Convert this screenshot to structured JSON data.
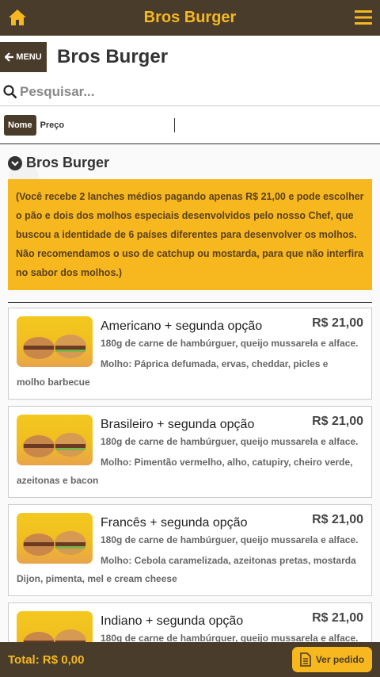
{
  "topbar": {
    "title": "Bros Burger",
    "home_icon": "home-icon",
    "menu_icon": "hamburger-menu-icon"
  },
  "header": {
    "menu_label": "MENU",
    "title": "Bros Burger"
  },
  "search": {
    "placeholder": "Pesquisar..."
  },
  "sort": {
    "active": "Nome",
    "other": "Preço"
  },
  "section": {
    "title": "Bros Burger"
  },
  "notice": "(Você recebe 2 lanches médios pagando apenas R$ 21,00 e pode escolher o pão e dois dos molhos especiais desenvolvidos pelo nosso Chef, que buscou a identidade de 6 países diferentes para desenvolver os molhos. Não recomendamos o uso de catchup ou mostarda, para que não interfira no sabor dos molhos.)",
  "products": [
    {
      "name": "Americano + segunda opção",
      "price": "R$ 21,00",
      "desc": "180g de carne de hambúrguer, queijo mussarela e alface.",
      "sauce": "Molho: Páprica defumada, ervas, cheddar, picles e molho barbecue"
    },
    {
      "name": "Brasileiro + segunda opção",
      "price": "R$ 21,00",
      "desc": "180g de carne de hambúrguer, queijo mussarela e alface.",
      "sauce": "Molho: Pimentão vermelho, alho, catupiry, cheiro verde, azeitonas e bacon"
    },
    {
      "name": "Francês + segunda opção",
      "price": "R$ 21,00",
      "desc": "180g de carne de hambúrguer, queijo mussarela e alface.",
      "sauce": "Molho: Cebola caramelizada, azeitonas pretas, mostarda Dijon, pimenta, mel e cream cheese"
    },
    {
      "name": "Indiano + segunda opção",
      "price": "R$ 21,00",
      "desc": "180g de carne de hambúrguer, queijo mussarela e alface.",
      "sauce": ""
    }
  ],
  "footer": {
    "total": "Total: R$ 0,00",
    "order_label": "Ver pedido"
  },
  "colors": {
    "brown": "#4a3c2a",
    "accent": "#f5b820"
  }
}
